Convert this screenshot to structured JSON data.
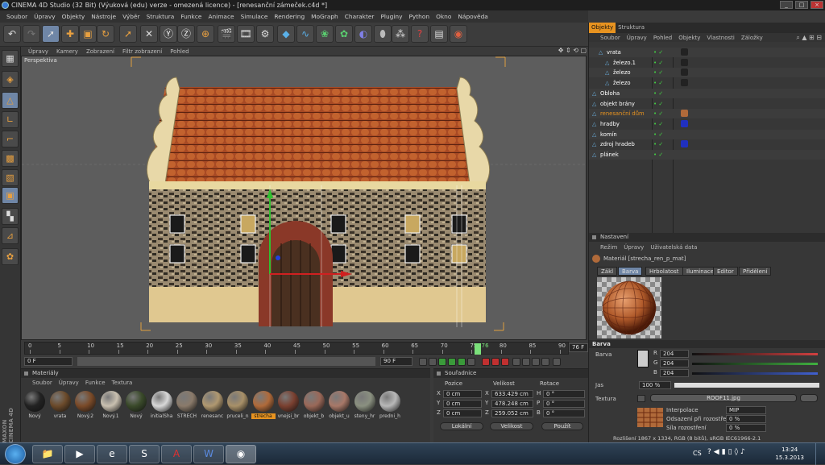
{
  "window": {
    "title": "CINEMA 4D Studio (32 Bit) (Výuková (edu) verze - omezená licence) - [renesanční zámeček.c4d *]"
  },
  "menubar": [
    "Soubor",
    "Úpravy",
    "Objekty",
    "Nástroje",
    "Výběr",
    "Struktura",
    "Funkce",
    "Animace",
    "Simulace",
    "Rendering",
    "MoGraph",
    "Charakter",
    "Pluginy",
    "Python",
    "Okno",
    "Nápověda"
  ],
  "viewport": {
    "menu": [
      "Úpravy",
      "Kamery",
      "Zobrazení",
      "Filtr zobrazení",
      "Pohled"
    ],
    "label": "Perspektiva"
  },
  "timeline": {
    "ticks": [
      "0",
      "5",
      "10",
      "15",
      "20",
      "25",
      "30",
      "35",
      "40",
      "45",
      "50",
      "55",
      "60",
      "65",
      "70",
      "75",
      "80",
      "85",
      "90"
    ],
    "current_frame": 76,
    "current_label": "76",
    "end_frame_label": "76 F",
    "start_field": "0 F",
    "end_field": "90 F",
    "preview_end": "90 F"
  },
  "materials": {
    "title": "Materiály",
    "menu": [
      "Soubor",
      "Úpravy",
      "Funkce",
      "Textura"
    ],
    "items": [
      {
        "name": "Nový",
        "color": "#222222"
      },
      {
        "name": "vrata",
        "color": "#6b4a2a"
      },
      {
        "name": "Nový.2",
        "color": "#7a4a28"
      },
      {
        "name": "Nový.1",
        "color": "#c9c0b0"
      },
      {
        "name": "Nový",
        "color": "#3a4a2a"
      },
      {
        "name": "initialSha",
        "color": "#d8d8d8"
      },
      {
        "name": "STRECH",
        "color": "#8a7a6a"
      },
      {
        "name": "renesanc",
        "color": "#b09870"
      },
      {
        "name": "pruceli_n",
        "color": "#a89068"
      },
      {
        "name": "strecha",
        "color": "#b06a3a"
      },
      {
        "name": "vnejsi_br",
        "color": "#7a4030"
      },
      {
        "name": "objekt_b",
        "color": "#9a6858"
      },
      {
        "name": "objekt_u",
        "color": "#a87868"
      },
      {
        "name": "steny_hr",
        "color": "#8a9080"
      },
      {
        "name": "predni_h",
        "color": "#b8b8b8"
      }
    ],
    "selected": "strecha"
  },
  "coordinates": {
    "title": "Souřadnice",
    "headers": {
      "position": "Pozice",
      "size": "Velikost",
      "rotation": "Rotace"
    },
    "rows": [
      {
        "axis": "X",
        "pos": "0 cm",
        "size": "633.429 cm",
        "rot_axis": "H",
        "rot": "0 °"
      },
      {
        "axis": "Y",
        "pos": "0 cm",
        "size": "478.248 cm",
        "rot_axis": "P",
        "rot": "0 °"
      },
      {
        "axis": "Z",
        "pos": "0 cm",
        "size": "259.052 cm",
        "rot_axis": "B",
        "rot": "0 °"
      }
    ],
    "mode": "Lokální",
    "size_mode": "Velikost",
    "apply": "Použít"
  },
  "objects_panel": {
    "tabs": [
      "Objekty",
      "Struktura"
    ],
    "menu": [
      "Soubor",
      "Úpravy",
      "Pohled",
      "Objekty",
      "Vlastnosti",
      "Záložky"
    ],
    "rows": [
      {
        "name": "vrata",
        "indent": 1,
        "color": "#ffffff"
      },
      {
        "name": "železo.1",
        "indent": 2,
        "color": "#ffffff"
      },
      {
        "name": "železo",
        "indent": 2,
        "color": "#ffffff"
      },
      {
        "name": "železo",
        "indent": 2,
        "color": "#ffffff"
      },
      {
        "name": "Obloha",
        "indent": 0,
        "color": "#ffffff"
      },
      {
        "name": "objekt brány",
        "indent": 0,
        "color": "#ffffff"
      },
      {
        "name": "renesanční dům",
        "indent": 0,
        "color": "#e79320"
      },
      {
        "name": "hradby",
        "indent": 0,
        "color": "#ffffff"
      },
      {
        "name": "komín",
        "indent": 0,
        "color": "#ffffff"
      },
      {
        "name": "zdroj hradeb",
        "indent": 0,
        "color": "#ffffff"
      },
      {
        "name": "plánek",
        "indent": 0,
        "color": "#ffffff"
      }
    ]
  },
  "attributes": {
    "title": "Nastavení",
    "menu": [
      "Režim",
      "Úpravy",
      "Uživatelská data"
    ],
    "material_name": "Materiál [strecha_ren_p_mat]",
    "tabs": [
      "Zákl",
      "Barva",
      "Hrbolatost",
      "Iluminace",
      "Editor",
      "Přidělení"
    ],
    "active_tab": "Barva",
    "section": "Barva",
    "color_label": "Barva",
    "rgb": [
      {
        "ch": "R",
        "val": "204",
        "color": "#d04040"
      },
      {
        "ch": "G",
        "val": "204",
        "color": "#40b040"
      },
      {
        "ch": "B",
        "val": "204",
        "color": "#4060d0"
      }
    ],
    "brightness_label": "Jas",
    "brightness": "100 %",
    "texture_label": "Textura",
    "texture_file": "ROOF11.jpg",
    "interp_label": "Interpolace",
    "interp": "MIP",
    "offset_label": "Odsazení při rozostření",
    "offset": "0 %",
    "blur_label": "Síla rozostření",
    "blur": "0 %",
    "resolution": "Rozlišení 1867 x 1334, RGB (8 bitů), sRGB IEC61966-2.1"
  },
  "taskbar": {
    "lang": "CS",
    "time": "13:24",
    "date": "15.3.2013"
  }
}
